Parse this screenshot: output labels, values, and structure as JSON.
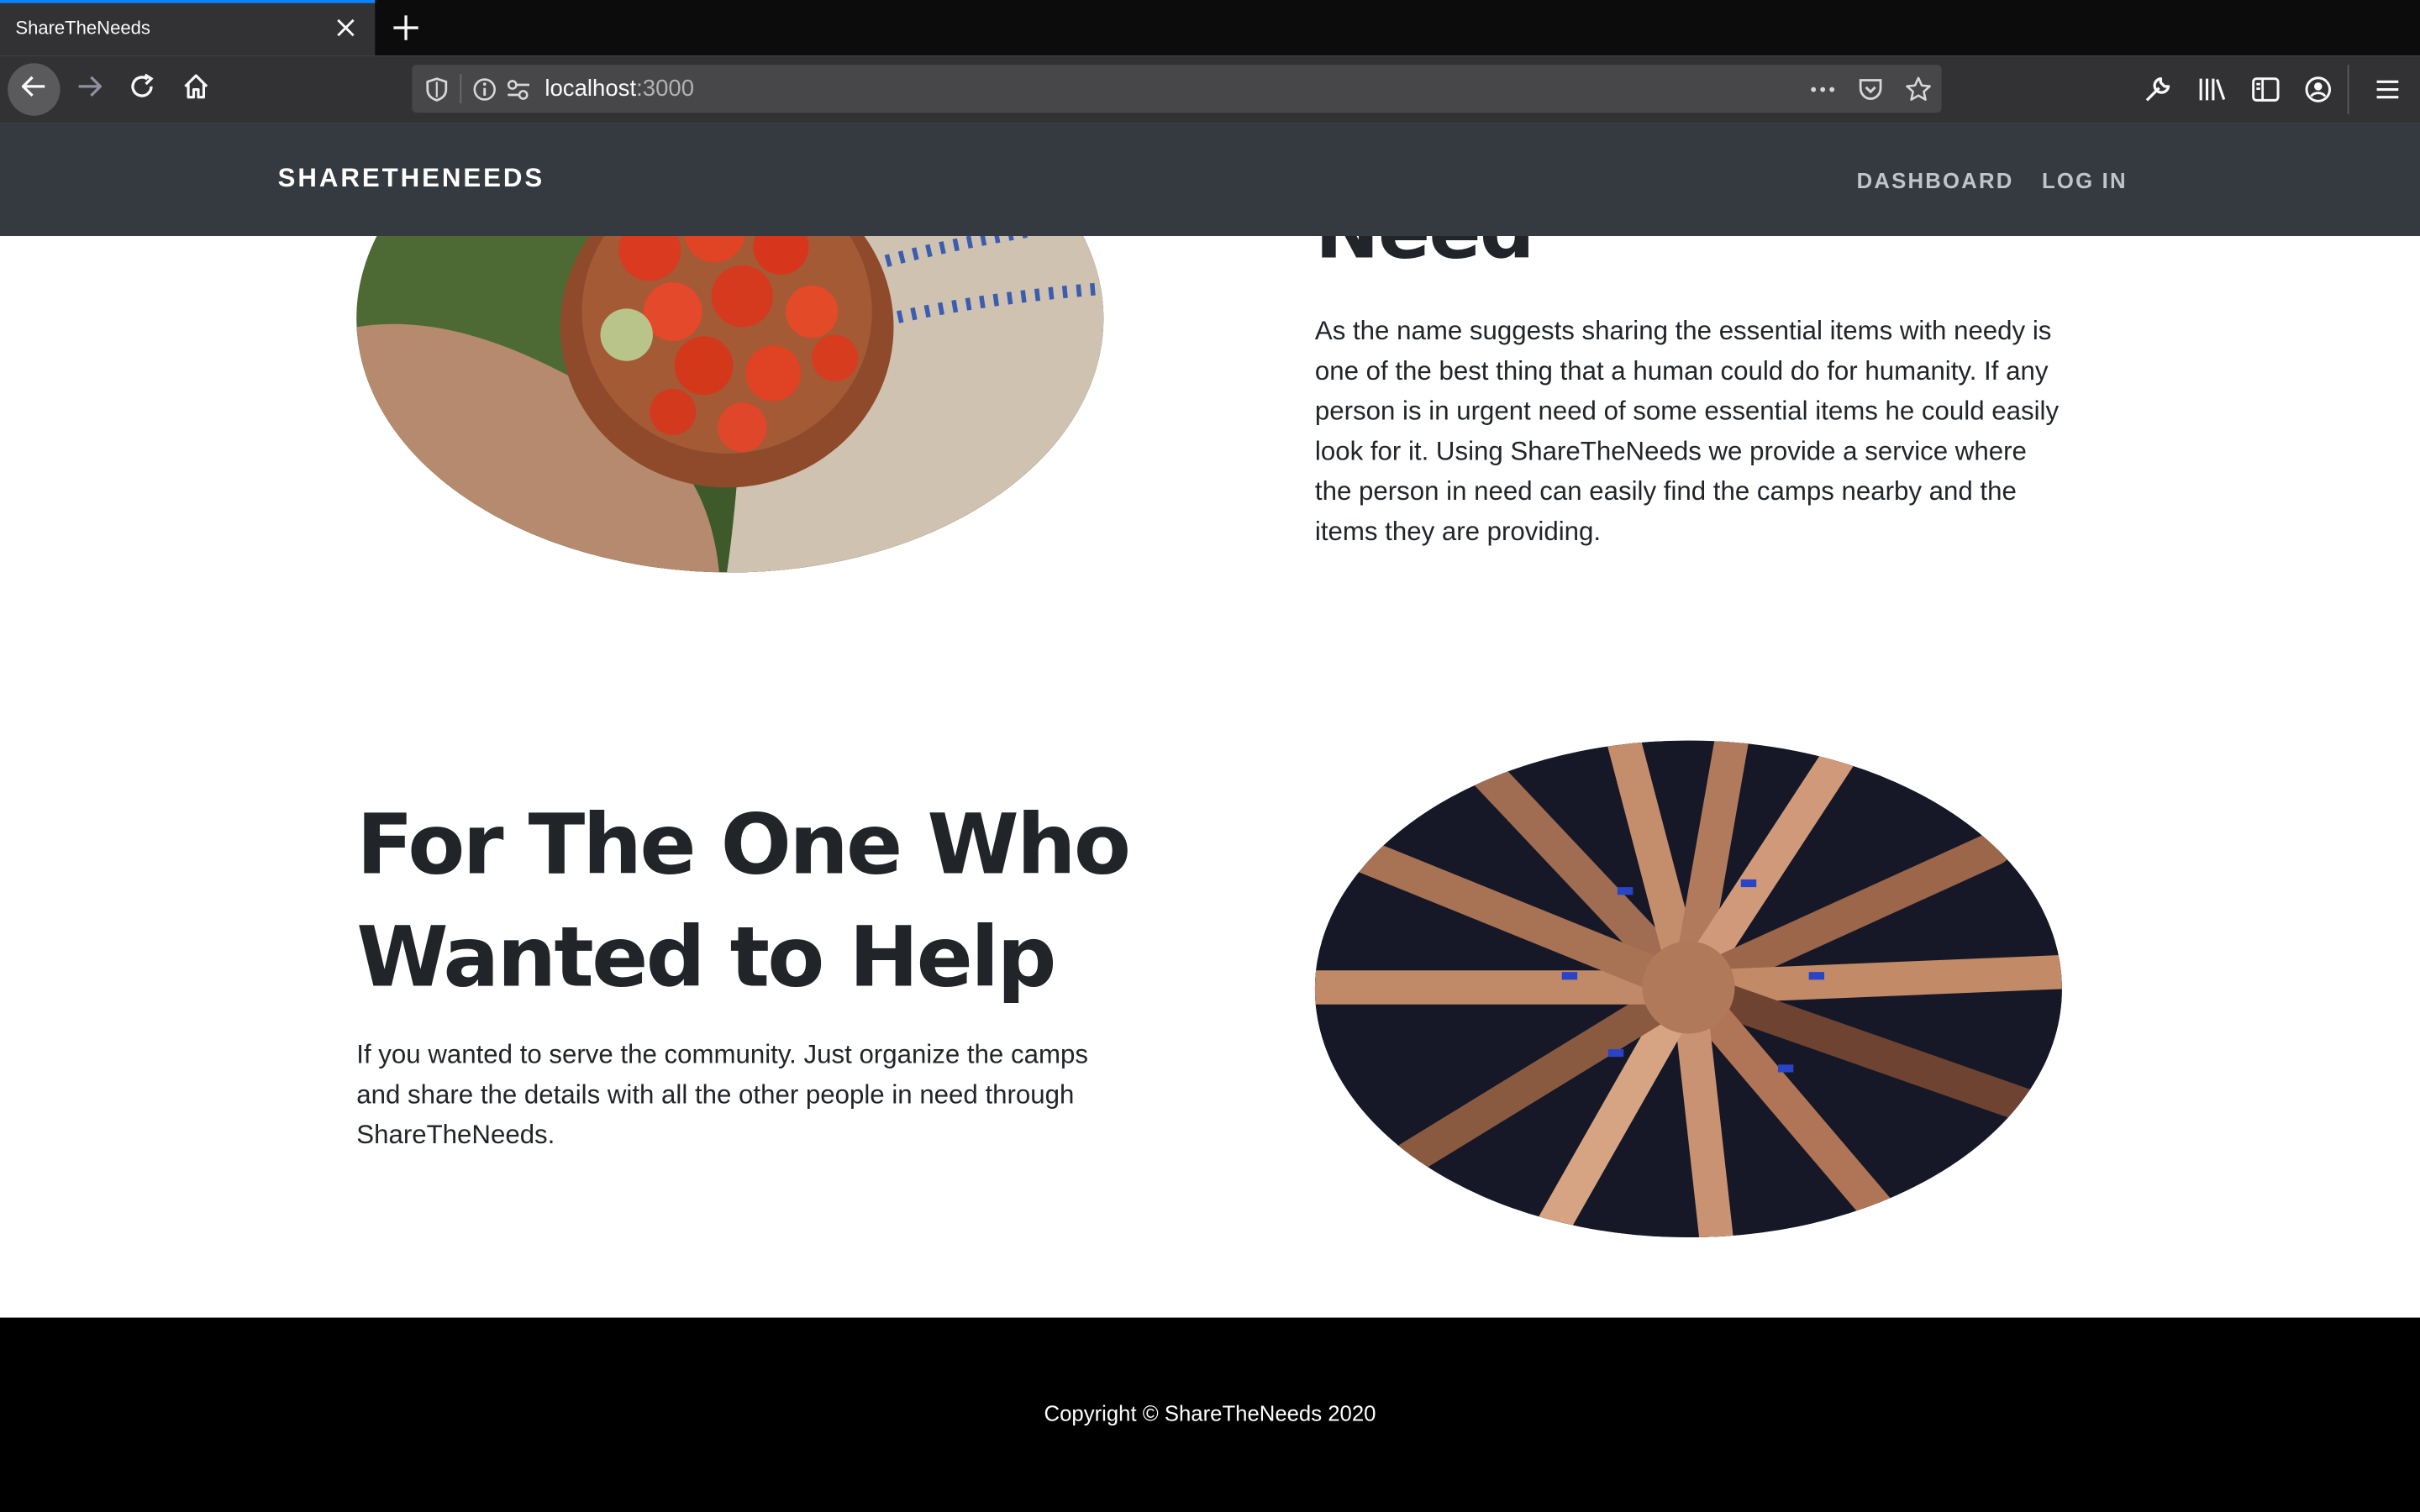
{
  "browser": {
    "tab_title": "ShareTheNeeds",
    "url_host": "localhost",
    "url_port": ":3000"
  },
  "site": {
    "brand": "SHARETHENEEDS",
    "nav": {
      "dashboard": "DASHBOARD",
      "login": "LOG IN"
    }
  },
  "sections": {
    "need": {
      "heading_partial": "Need",
      "paragraph": "As the name suggests sharing the essential items with needy is one of the best thing that a human could do for humanity. If any person is in urgent need of some essential items he could easily look for it. Using ShareTheNeeds we provide a service where the person in need can easily find the camps nearby and the items they are providing."
    },
    "help": {
      "heading": "For The One Who Wanted to Help",
      "paragraph": "If you wanted to serve the community. Just organize the camps and share the details with all the other people in need through ShareTheNeeds."
    }
  },
  "footer": {
    "copyright": "Copyright © ShareTheNeeds 2020"
  },
  "icons": {
    "tab_close": "close-icon",
    "new_tab": "plus-icon",
    "back": "arrow-left-icon",
    "forward": "arrow-right-icon",
    "reload": "reload-icon",
    "home": "home-icon",
    "tracking": "shield-icon",
    "site_info": "info-icon",
    "permissions": "permissions-icon",
    "page_actions": "more-icon",
    "pocket": "pocket-icon",
    "bookmark": "star-icon",
    "devtools": "wrench-icon",
    "library": "library-icon",
    "sidebar": "sidebar-icon",
    "account": "account-icon",
    "menu": "hamburger-icon"
  },
  "colors": {
    "site_nav_bg": "#343a40",
    "footer_bg": "#000000",
    "tab_accent": "#0a84ff"
  }
}
